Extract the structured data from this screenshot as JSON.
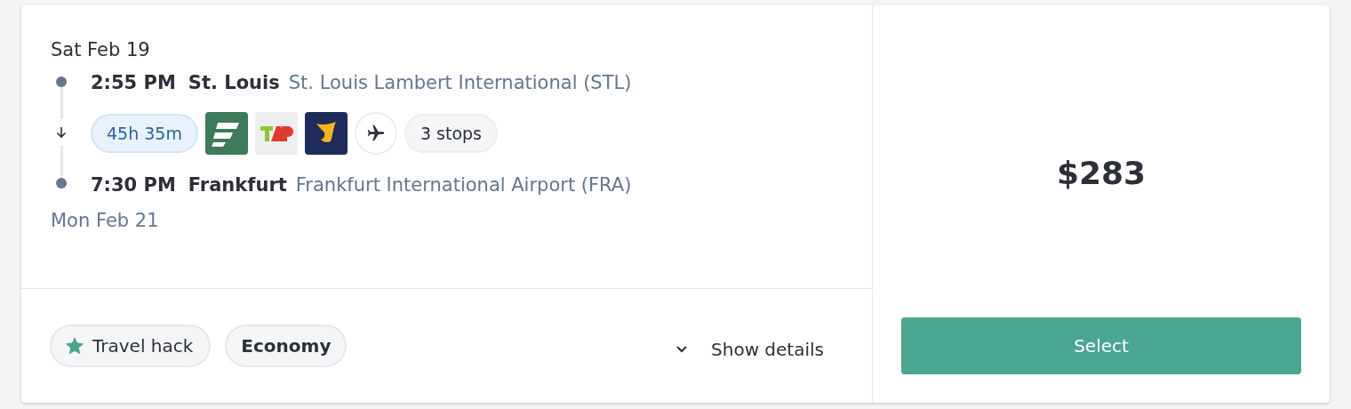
{
  "departure_date": "Sat Feb 19",
  "departure": {
    "time": "2:55 PM",
    "city": "St. Louis",
    "airport": "St. Louis Lambert International (STL)"
  },
  "duration": "45h 35m",
  "stops": "3 stops",
  "arrival": {
    "time": "7:30 PM",
    "city": "Frankfurt",
    "airport": "Frankfurt International Airport (FRA)"
  },
  "arrival_date": "Mon Feb 21",
  "tags": [
    {
      "label": "Travel hack",
      "kind": "star"
    },
    {
      "label": "Economy",
      "kind": "plain"
    }
  ],
  "details_link": "Show details",
  "price": "$283",
  "select_button": "Select"
}
